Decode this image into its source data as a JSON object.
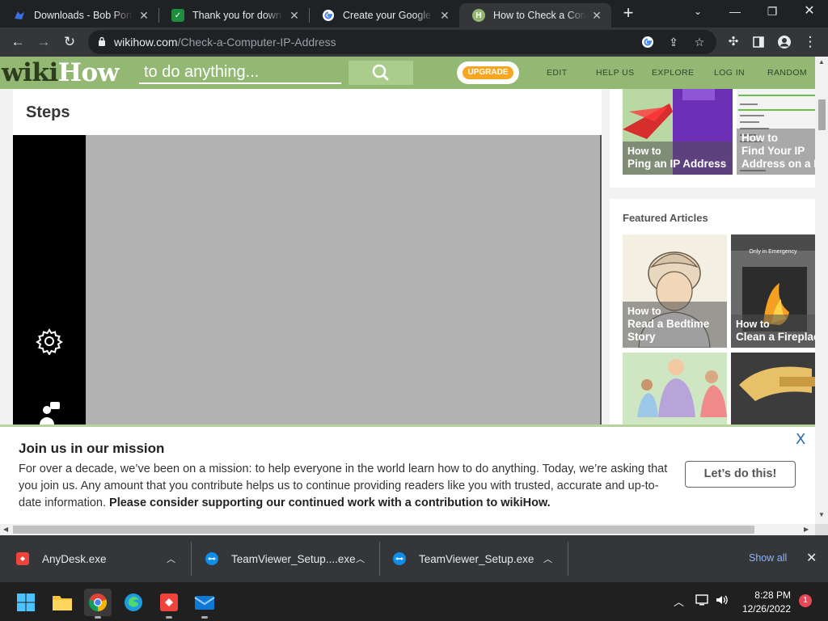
{
  "browser": {
    "tabs": [
      {
        "title": "Downloads - Bob Pony",
        "favicon": "bobpony-icon",
        "active": false
      },
      {
        "title": "Thank you for downloading",
        "favicon": "sheets-icon",
        "active": false
      },
      {
        "title": "Create your Google Account",
        "favicon": "google-icon",
        "active": false
      },
      {
        "title": "How to Check a Computer IP Address",
        "favicon": "wikihow-icon",
        "active": true
      }
    ],
    "new_tab_label": "+",
    "url_host": "wikihow.com",
    "url_path": "/Check-a-Computer-IP-Address"
  },
  "wikihow": {
    "logo_part1": "wiki",
    "logo_part2": "How",
    "search_placeholder": "to do anything...",
    "upgrade_label": "UPGRADE",
    "nav": [
      "EDIT",
      "HELP US",
      "EXPLORE",
      "LOG IN",
      "RANDOM"
    ],
    "steps_title": "Steps",
    "related": [
      {
        "howto": "How to",
        "title": "Ping an IP Address"
      },
      {
        "howto": "How to",
        "title_line1": "Find Your IP",
        "title_line2": "Address on a Mac"
      }
    ],
    "featured_title": "Featured Articles",
    "featured": [
      {
        "howto": "How to",
        "title_line1": "Read a Bedtime",
        "title_line2": "Story"
      },
      {
        "howto": "How to",
        "title_line1": "Clean a Fireplace",
        "badge": "Only in Emergency"
      }
    ]
  },
  "banner": {
    "title": "Join us in our mission",
    "text": "For over a decade, we’ve been on a mission: to help everyone in the world learn how to do anything. Today, we’re asking that you join us. Any amount that you contribute helps us to continue providing readers like you with trusted, accurate and up-to-date information.",
    "text_bold": "Please consider supporting our continued work with a contribution to wikiHow.",
    "button_label": "Let’s do this!",
    "close_label": "X"
  },
  "downloads": {
    "items": [
      {
        "name": "AnyDesk.exe",
        "icon": "anydesk-icon"
      },
      {
        "name": "TeamViewer_Setup....exe",
        "icon": "teamviewer-icon"
      },
      {
        "name": "TeamViewer_Setup.exe",
        "icon": "teamviewer-icon"
      }
    ],
    "show_all_label": "Show all"
  },
  "taskbar": {
    "apps": [
      "start-icon",
      "file-explorer-icon",
      "chrome-icon",
      "edge-icon",
      "anydesk-icon",
      "mail-icon"
    ],
    "time": "8:28 PM",
    "date": "12/26/2022",
    "notification_count": "1"
  }
}
